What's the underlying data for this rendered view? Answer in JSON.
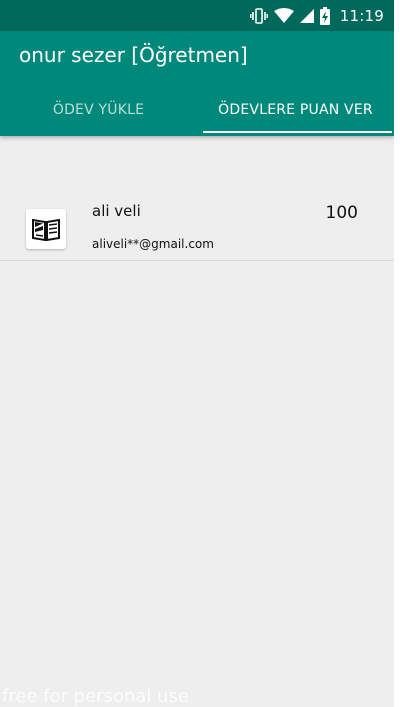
{
  "status_bar": {
    "time": "11:19",
    "icons": [
      "vibrate-icon",
      "wifi-icon",
      "signal-icon",
      "battery-charging-icon"
    ]
  },
  "app_bar": {
    "title": "onur sezer [Öğretmen]",
    "tabs": [
      {
        "label": "ÖDEV YÜKLE",
        "active": false
      },
      {
        "label": "ÖDEVLERE PUAN VER",
        "active": true
      }
    ]
  },
  "list": {
    "items": [
      {
        "icon": "book-icon",
        "name": "ali veli",
        "email": "aliveli**@gmail.com",
        "score": "100"
      }
    ]
  },
  "watermark": "free for personal use",
  "colors": {
    "status_bar": "#00695c",
    "primary": "#00897b",
    "background": "#eeeeee"
  }
}
